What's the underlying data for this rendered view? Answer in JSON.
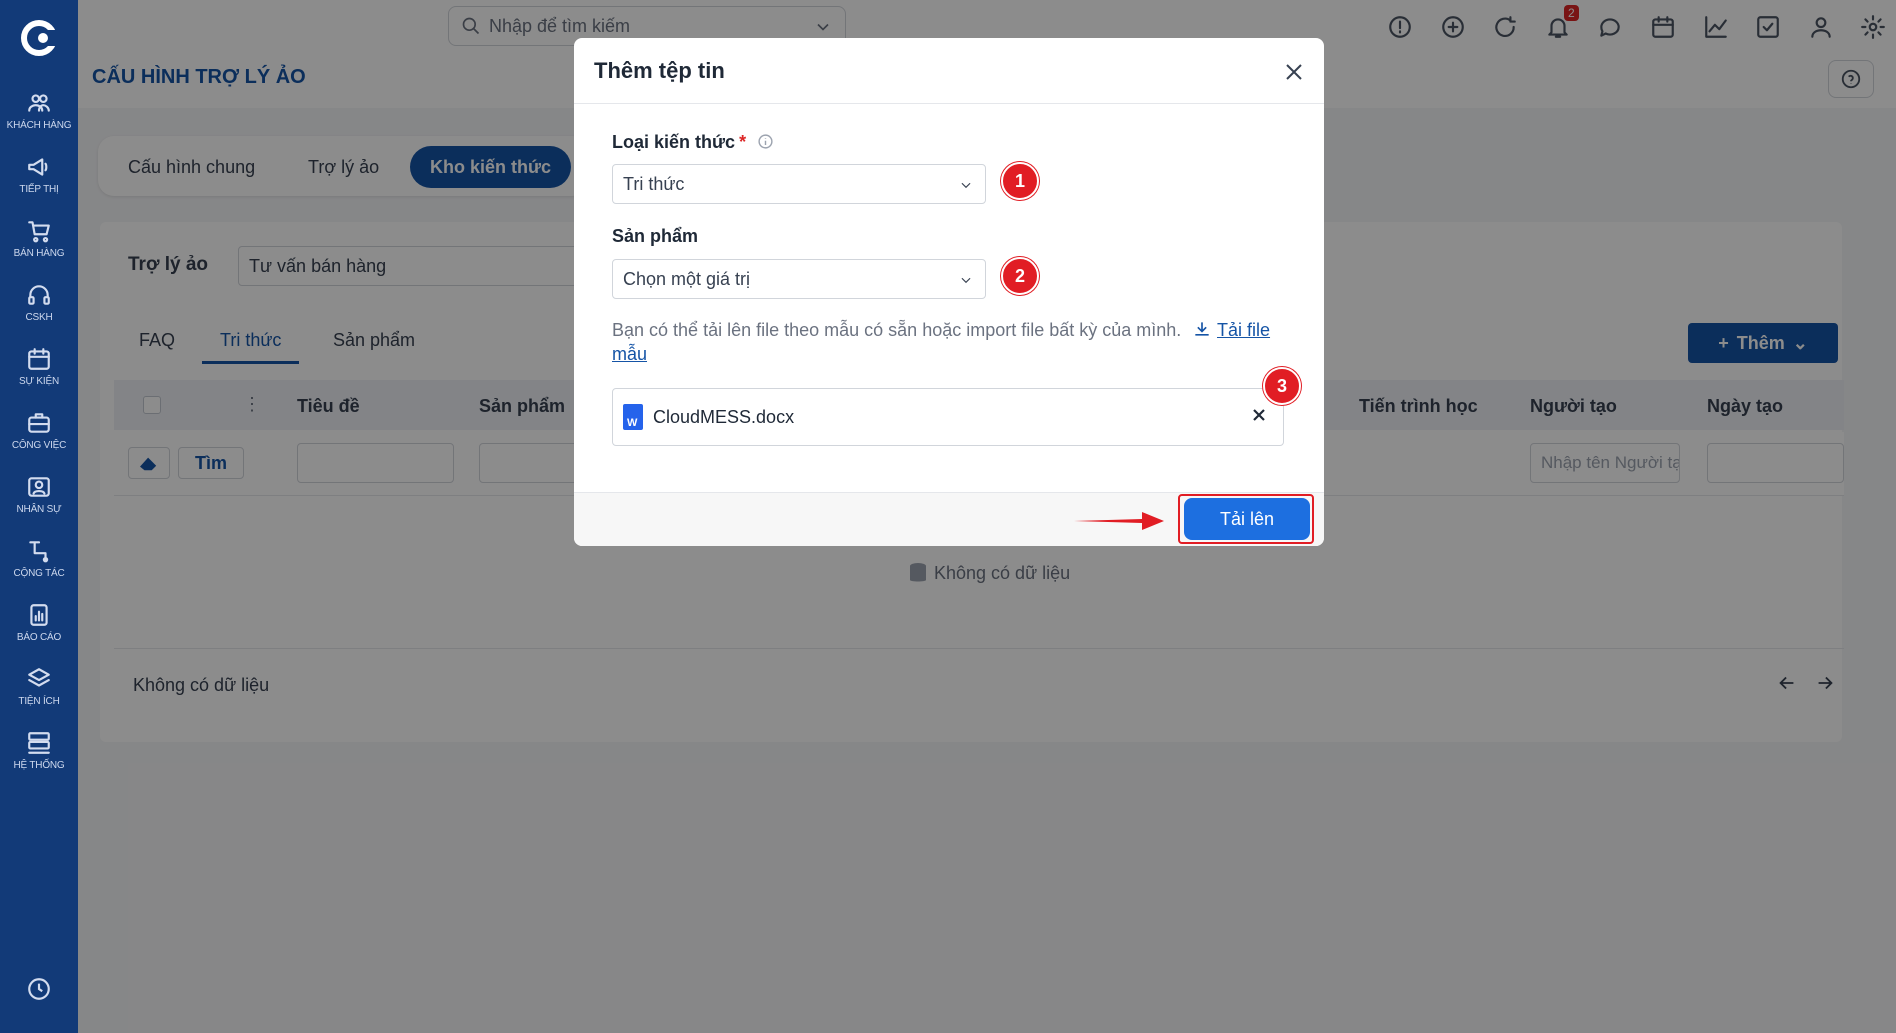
{
  "sidebar": {
    "items": [
      {
        "label": "KHÁCH HÀNG",
        "icon": "users-icon"
      },
      {
        "label": "TIẾP THỊ",
        "icon": "megaphone-icon"
      },
      {
        "label": "BÁN HÀNG",
        "icon": "cart-icon"
      },
      {
        "label": "CSKH",
        "icon": "headset-icon"
      },
      {
        "label": "SỰ KIỆN",
        "icon": "calendar-icon"
      },
      {
        "label": "CÔNG VIỆC",
        "icon": "briefcase-icon"
      },
      {
        "label": "NHÂN SỰ",
        "icon": "id-card-icon"
      },
      {
        "label": "CỘNG TÁC",
        "icon": "network-icon"
      },
      {
        "label": "BÁO CÁO",
        "icon": "report-icon"
      },
      {
        "label": "TIỆN ÍCH",
        "icon": "layers-icon"
      },
      {
        "label": "HỆ THỐNG",
        "icon": "server-icon"
      }
    ]
  },
  "header": {
    "search_placeholder": "Nhập để tìm kiếm",
    "notification_count": "2",
    "page_title": "CẤU HÌNH TRỢ LÝ ẢO"
  },
  "tabs": {
    "general": "Cấu hình chung",
    "assistant": "Trợ lý ảo",
    "knowledge": "Kho kiến thức"
  },
  "panel": {
    "assistant_label": "Trợ lý ảo",
    "assistant_value": "Tư vấn bán hàng",
    "subtabs": [
      "FAQ",
      "Tri thức",
      "Sản phẩm"
    ],
    "add_button": "Thêm",
    "columns": [
      "Tiêu đề",
      "Sản phẩm",
      "Tiến trình học",
      "Người tạo",
      "Ngày tạo"
    ],
    "search_button": "Tìm",
    "creator_placeholder": "Nhập tên Người tạo",
    "empty_text": "Không có dữ liệu",
    "footer_text": "Không có dữ liệu"
  },
  "modal": {
    "title": "Thêm tệp tin",
    "type_label": "Loại kiến thức",
    "required_mark": "*",
    "type_value": "Tri thức",
    "product_label": "Sản phẩm",
    "product_value": "Chọn một giá trị",
    "hint_text": "Bạn có thể tải lên file theo mẫu có sẵn hoặc import file bất kỳ của mình.",
    "template_link": "Tải file mẫu",
    "file_name": "CloudMESS.docx",
    "upload_button": "Tải lên",
    "steps": [
      "1",
      "2",
      "3"
    ]
  },
  "colors": {
    "sidebar": "#123a78",
    "primary": "#1554a6",
    "upload": "#1d6fe0",
    "highlight": "#e11d24"
  }
}
